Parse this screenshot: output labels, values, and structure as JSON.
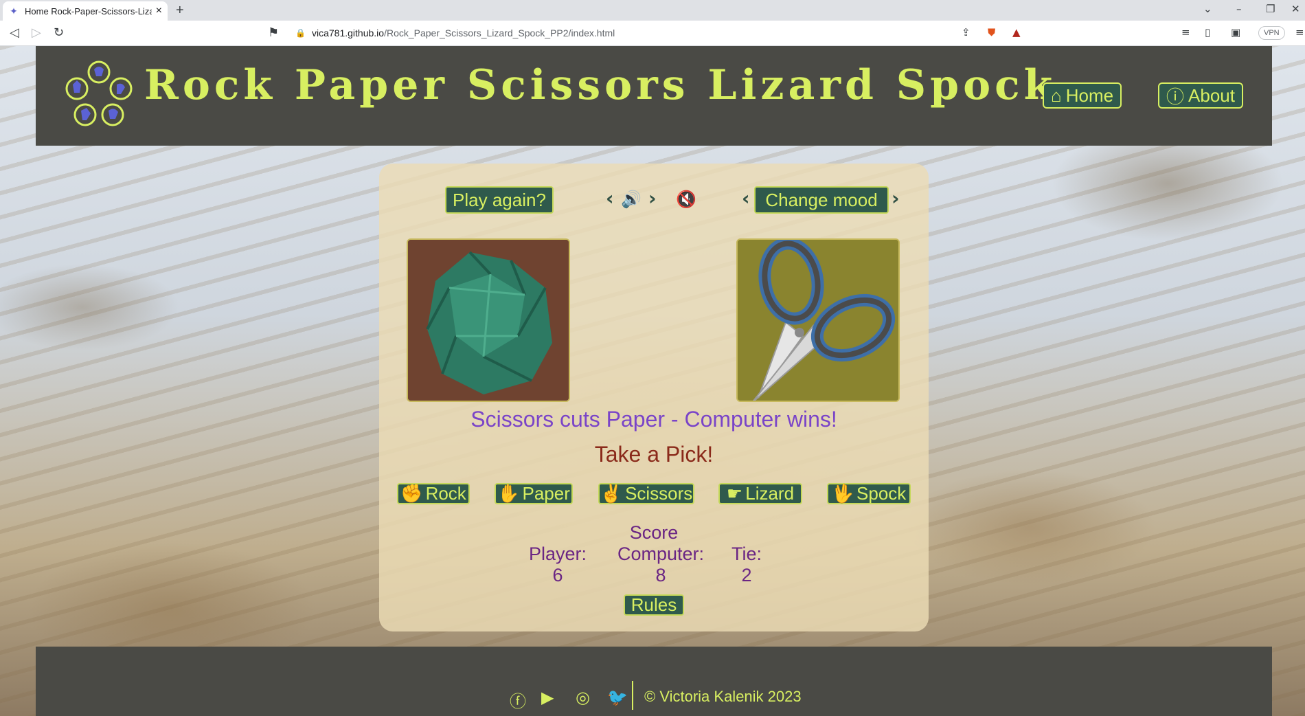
{
  "browser": {
    "tab_title": "Home Rock-Paper-Scissors-Lizard",
    "new_tab": "+",
    "url_domain": "vica781.github.io",
    "url_path": "/Rock_Paper_Scissors_Lizard_Spock_PP2/index.html",
    "vpn_label": "VPN"
  },
  "header": {
    "title": "Rock Paper Scissors Lizard Spock",
    "nav": [
      {
        "label": "Home",
        "icon": "home-icon"
      },
      {
        "label": "About",
        "icon": "info-icon"
      }
    ]
  },
  "game": {
    "play_again_label": "Play again?",
    "change_mood_label": "Change mood",
    "player_choice_image": "crumpled-paper",
    "computer_choice_image": "scissors",
    "result_message": "Scissors cuts Paper - Computer wins!",
    "prompt": "Take a Pick!",
    "choices": [
      {
        "label": "Rock",
        "icon": "fist-icon"
      },
      {
        "label": "Paper",
        "icon": "open-hand-icon"
      },
      {
        "label": "Scissors",
        "icon": "scissors-hand-icon"
      },
      {
        "label": "Lizard",
        "icon": "lizard-hand-icon"
      },
      {
        "label": "Spock",
        "icon": "spock-hand-icon"
      }
    ],
    "score": {
      "heading": "Score",
      "player_label": "Player:",
      "player_value": "6",
      "computer_label": "Computer:",
      "computer_value": "8",
      "tie_label": "Tie:",
      "tie_value": "2"
    },
    "rules_label": "Rules"
  },
  "footer": {
    "copyright": "© Victoria Kalenik 2023",
    "social": [
      "facebook-icon",
      "youtube-icon",
      "instagram-icon",
      "twitter-icon"
    ]
  },
  "colors": {
    "accent": "#d8ef61",
    "button_bg": "#2f5a4c",
    "header_bg": "#4a4a45",
    "result_text": "#7a44c8",
    "prompt_text": "#8a2a1a",
    "score_text": "#6a2584"
  }
}
